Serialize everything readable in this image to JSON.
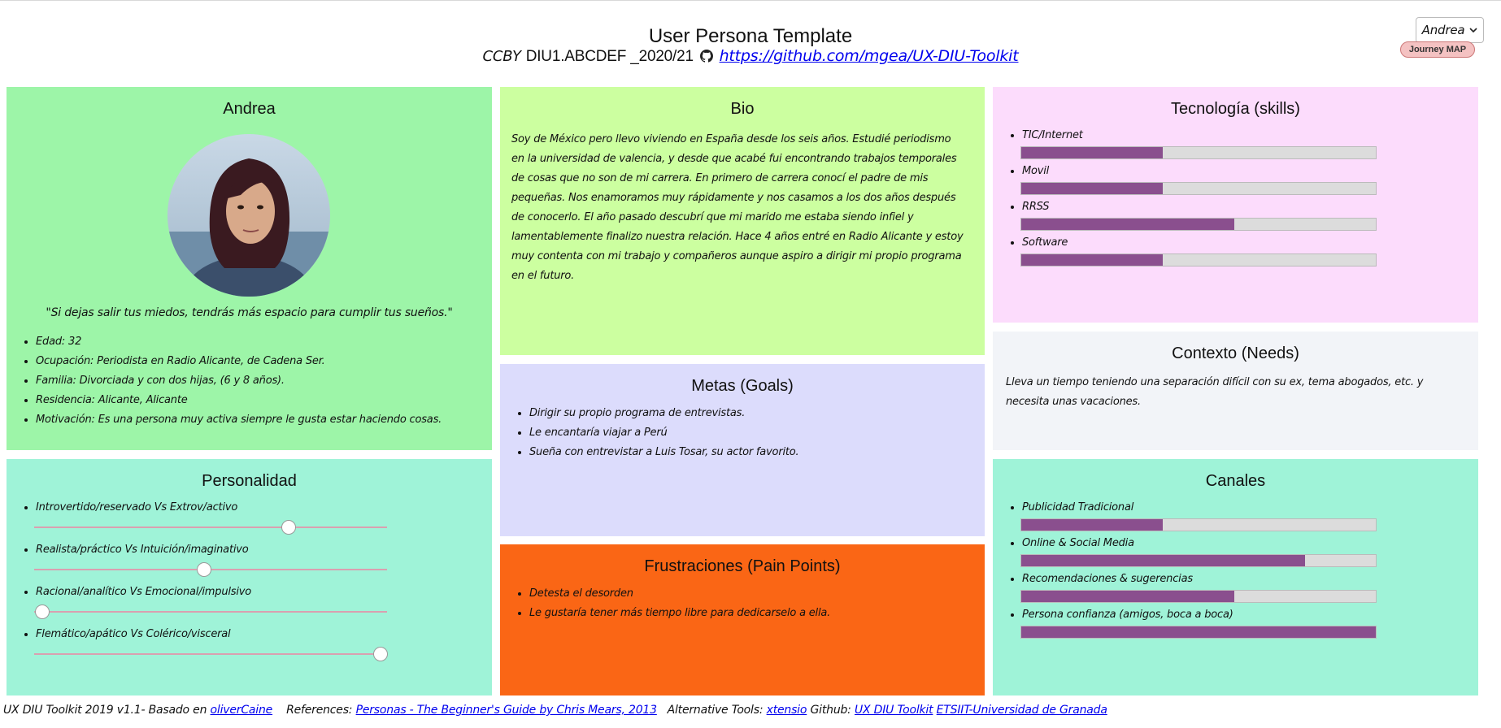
{
  "header": {
    "title": "User Persona Template",
    "cc_label": "CCBY",
    "course_code": "DIU1.ABCDEF _2020/21",
    "repo_link": "https://github.com/mgea/UX-DIU-Toolkit"
  },
  "controls": {
    "persona_select": "Andrea",
    "journey_button": "Journey MAP"
  },
  "persona": {
    "name": "Andrea",
    "quote": "\"Si dejas salir tus miedos, tendrás más espacio para cumplir tus sueños.\"",
    "details": [
      "Edad: 32",
      "Ocupación: Periodista en Radio Alicante, de Cadena Ser.",
      "Familia: Divorciada y con dos hijas, (6 y 8 años).",
      "Residencia: Alicante, Alicante",
      "Motivación: Es una persona muy activa siempre le gusta estar haciendo cosas."
    ]
  },
  "bio": {
    "title": "Bio",
    "text": "Soy de México pero llevo viviendo en España desde los seis años. Estudié periodismo en la universidad de valencia, y desde que acabé fui encontrando trabajos temporales de cosas que no son de mi carrera. En primero de carrera conocí el padre de mis pequeñas. Nos enamoramos muy rápidamente y nos casamos a los dos años después de conocerlo. El año pasado descubrí que mi marido me estaba siendo infiel y lamentablemente finalizo nuestra relación. Hace 4 años entré en Radio Alicante y estoy muy contenta con mi trabajo y compañeros aunque aspiro a dirigir mi propio programa en el futuro."
  },
  "tech": {
    "title": "Tecnología (skills)",
    "skills": [
      {
        "label": "TIC/Internet",
        "value": 0.4
      },
      {
        "label": "Movil",
        "value": 0.4
      },
      {
        "label": "RRSS",
        "value": 0.6
      },
      {
        "label": "Software",
        "value": 0.4
      }
    ]
  },
  "personality": {
    "title": "Personalidad",
    "traits": [
      {
        "label": "Introvertido/reservado Vs Extrov/activo",
        "value": 0.72
      },
      {
        "label": "Realista/práctico Vs Intuición/imaginativo",
        "value": 0.48
      },
      {
        "label": "Racional/analítico Vs Emocional/impulsivo",
        "value": 0.02
      },
      {
        "label": "Flemático/apático Vs Colérico/visceral",
        "value": 0.98
      }
    ]
  },
  "goals": {
    "title": "Metas (Goals)",
    "items": [
      "Dirigir su propio programa de entrevistas.",
      "Le encantaría viajar a Perú",
      "Sueña con entrevistar a Luis Tosar, su actor favorito."
    ]
  },
  "pain": {
    "title": "Frustraciones (Pain Points)",
    "items": [
      "Detesta el desorden",
      "Le gustaría tener más tiempo libre para dedicarselo a ella."
    ]
  },
  "needs": {
    "title": "Contexto (Needs)",
    "text": "Lleva un tiempo teniendo una separación difícil con su ex, tema abogados, etc. y necesita unas vacaciones."
  },
  "channels": {
    "title": "Canales",
    "items": [
      {
        "label": "Publicidad Tradicional",
        "value": 0.4
      },
      {
        "label": "Online & Social Media",
        "value": 0.8
      },
      {
        "label": "Recomendaciones & sugerencias",
        "value": 0.6
      },
      {
        "label": "Persona confianza (amigos, boca a boca)",
        "value": 1.0
      }
    ]
  },
  "footer": {
    "prefix": "UX DIU Toolkit 2019 v1.1- Basado en",
    "based_link": "oliverCaine",
    "references_label": "References:",
    "references_link": "Personas - The Beginner's Guide by Chris Mears, 2013",
    "alt_label": "Alternative Tools:",
    "alt_link": "xtensio",
    "github_label": "Github:",
    "github_link": "UX DIU Toolkit",
    "univ_link": "ETSIIT-Universidad de Granada"
  },
  "colors": {
    "persona_bg": "#9df5a8",
    "bio_bg": "#ccffa0",
    "tech_bg": "#fcdcfc",
    "personality_bg": "#9ff3d8",
    "goals_bg": "#dcdcfc",
    "pain_bg": "#fa6615",
    "needs_bg": "#f2f4f8",
    "channels_bg": "#9ff3d8",
    "bar_fill": "#8a4f8e"
  },
  "icons": [
    "github-icon",
    "chevron-down-icon",
    "avatar-photo"
  ]
}
